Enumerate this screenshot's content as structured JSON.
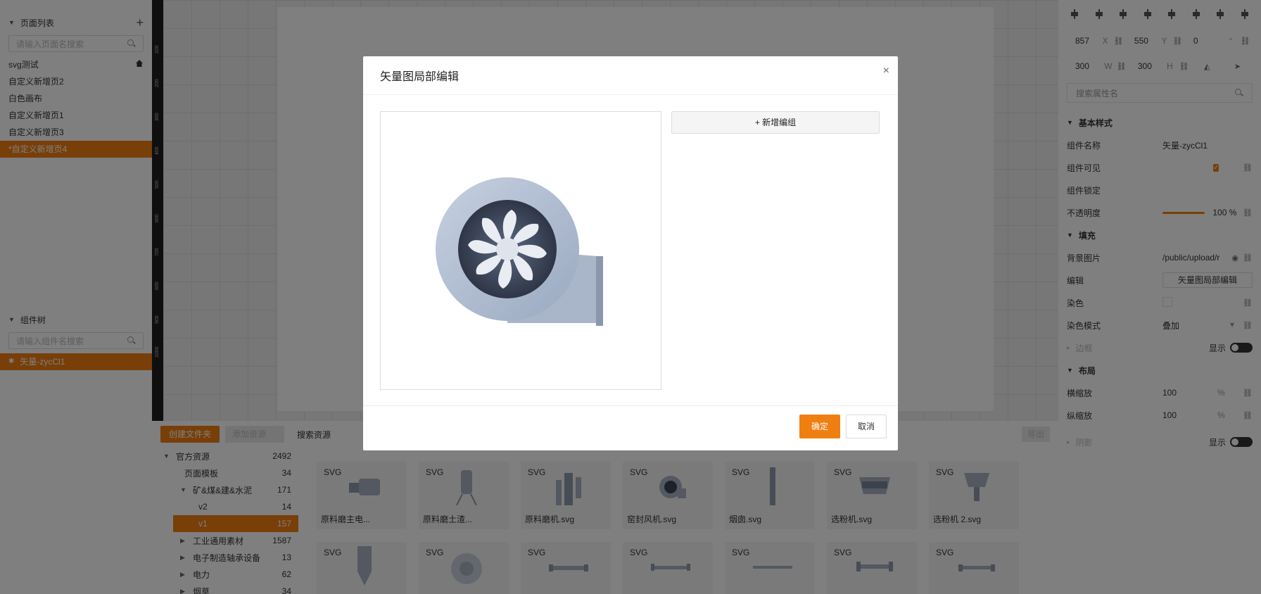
{
  "pages": {
    "header": "页面列表",
    "search_placeholder": "请输入页面名搜索",
    "items": [
      {
        "label": "svg测试",
        "home": true
      },
      {
        "label": "自定义新增页2"
      },
      {
        "label": "白色画布"
      },
      {
        "label": "自定义新增页1"
      },
      {
        "label": "自定义新增页3"
      },
      {
        "label": "*自定义新增页4",
        "active": true
      }
    ]
  },
  "component_tree": {
    "header": "组件树",
    "search_placeholder": "请输入组件名搜索",
    "selected": "矢量-zycCl1"
  },
  "ruler": {
    "ticks": [
      "100",
      "200",
      "300",
      "400",
      "500",
      "600",
      "700",
      "800",
      "900",
      "1000"
    ]
  },
  "properties": {
    "x": "857",
    "x_label": "X",
    "y": "550",
    "y_label": "Y",
    "rotation": "0",
    "rotation_unit": "°",
    "w": "300",
    "w_label": "W",
    "h": "300",
    "h_label": "H",
    "search_placeholder": "搜索属性名",
    "basic_title": "基本样式",
    "name_label": "组件名称",
    "name_value": "矢量-zycCl1",
    "visible_label": "组件可见",
    "lock_label": "组件锁定",
    "opacity_label": "不透明度",
    "opacity_value": "100 %",
    "opacity_level": 1.0,
    "fill_title": "填充",
    "bg_label": "背景图片",
    "bg_value": "/public/upload/r",
    "edit_label": "编辑",
    "edit_button": "矢量图局部编辑",
    "tint_label": "染色",
    "tint_mode_label": "染色模式",
    "tint_mode_value": "叠加",
    "border_title": "边框",
    "show_label": "显示",
    "layout_title": "布局",
    "hscale_label": "横缩放",
    "hscale_value": "100",
    "pct": "%",
    "vscale_label": "纵缩放",
    "vscale_value": "100",
    "shadow_title": "阴影",
    "shadow_show": "显示"
  },
  "assets": {
    "create_folder": "创建文件夹",
    "add_resource": "添加资源",
    "search_resource": "搜索资源",
    "export": "导出",
    "tree": [
      {
        "label": "官方资源",
        "count": "2492",
        "level": 0,
        "expanded": true
      },
      {
        "label": "页面模板",
        "count": "34",
        "level": 1
      },
      {
        "label": "矿&煤&建&水泥",
        "count": "171",
        "level": 1,
        "expanded": true
      },
      {
        "label": "v2",
        "count": "14",
        "level": 2
      },
      {
        "label": "v1",
        "count": "157",
        "level": 2,
        "active": true
      },
      {
        "label": "工业通用素材",
        "count": "1587",
        "level": 1,
        "collapsed": true
      },
      {
        "label": "电子制造轴承设备",
        "count": "13",
        "level": 1,
        "collapsed": true
      },
      {
        "label": "电力",
        "count": "62",
        "level": 1,
        "collapsed": true
      },
      {
        "label": "烟草",
        "count": "34",
        "level": 1,
        "collapsed": true
      }
    ],
    "cards_row1": [
      {
        "tag": "SVG",
        "caption": "原料磨主电..."
      },
      {
        "tag": "SVG",
        "caption": "原料磨土渣..."
      },
      {
        "tag": "SVG",
        "caption": "原料磨机.svg"
      },
      {
        "tag": "SVG",
        "caption": "窑封风机.svg"
      },
      {
        "tag": "SVG",
        "caption": "烟囱.svg"
      },
      {
        "tag": "SVG",
        "caption": "选粉机.svg"
      },
      {
        "tag": "SVG",
        "caption": "选粉机 2.svg"
      }
    ],
    "cards_row2": [
      {
        "tag": "SVG"
      },
      {
        "tag": "SVG"
      },
      {
        "tag": "SVG"
      },
      {
        "tag": "SVG"
      },
      {
        "tag": "SVG"
      },
      {
        "tag": "SVG"
      },
      {
        "tag": "SVG"
      }
    ]
  },
  "modal": {
    "title": "矢量图局部编辑",
    "close": "×",
    "add_group": "+ 新增编组",
    "ok": "确定",
    "cancel": "取消"
  },
  "colors": {
    "accent": "#f07f12"
  }
}
